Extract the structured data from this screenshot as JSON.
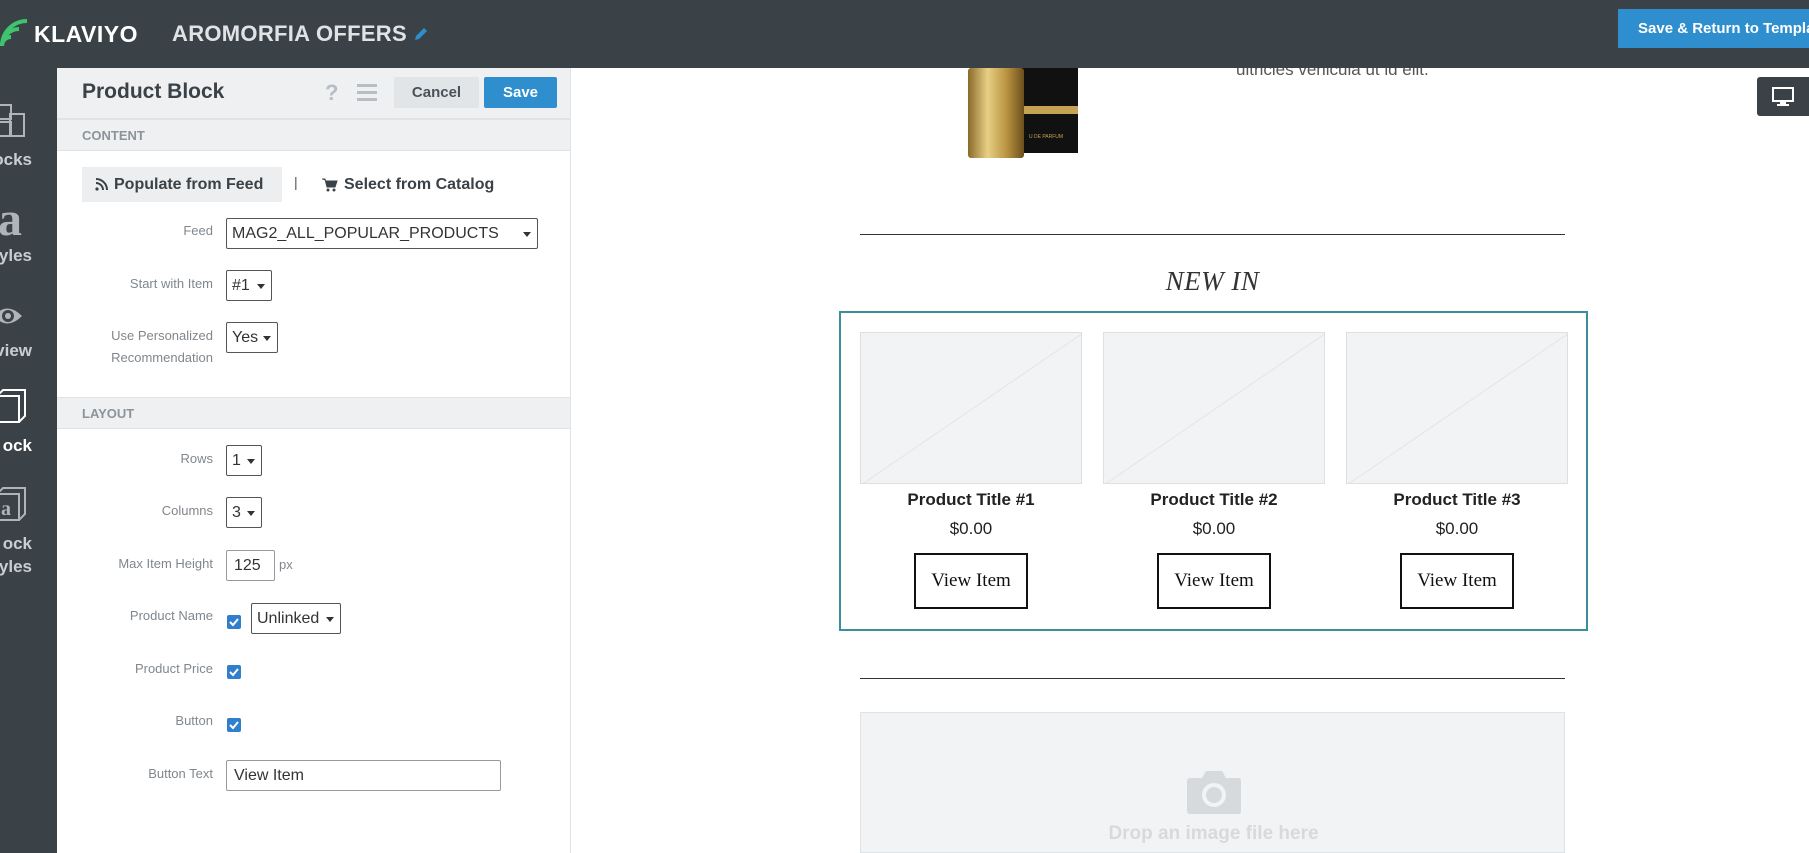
{
  "app": {
    "logo_text": "KLAVIYO",
    "campaign_title": "AROMORFIA OFFERS",
    "save_return_label": "Save & Return to Template"
  },
  "rail": {
    "items": [
      {
        "label": "ocks",
        "icon": "blocks-icon"
      },
      {
        "label": "yles",
        "icon": "styles-icon"
      },
      {
        "label": "eview",
        "icon": "preview-icon"
      },
      {
        "label": "ock",
        "icon": "block-icon"
      },
      {
        "label_line1": "ock",
        "label_line2": "yles",
        "icon": "block-styles-icon"
      }
    ]
  },
  "panel": {
    "title": "Product Block",
    "help": "?",
    "cancel_label": "Cancel",
    "save_label": "Save",
    "content_heading": "CONTENT",
    "populate_feed_label": "Populate from Feed",
    "separator": "|",
    "select_catalog_label": "Select from Catalog",
    "feed_label": "Feed",
    "feed_value": "MAG2_ALL_POPULAR_PRODUCTS",
    "start_label": "Start with Item",
    "start_value": "#1",
    "personalized_label_1": "Use Personalized",
    "personalized_label_2": "Recommendation",
    "personalized_value": "Yes",
    "layout_heading": "LAYOUT",
    "rows_label": "Rows",
    "rows_value": "1",
    "columns_label": "Columns",
    "columns_value": "3",
    "max_height_label": "Max Item Height",
    "max_height_value": "125",
    "max_height_unit": "px",
    "product_name_label": "Product Name",
    "product_name_checked": true,
    "product_name_link_value": "Unlinked",
    "product_price_label": "Product Price",
    "product_price_checked": true,
    "button_label": "Button",
    "button_checked": true,
    "button_text_label": "Button Text",
    "button_text_value": "View Item"
  },
  "canvas": {
    "lorem_text": "ultricies vehicula ut id elit.",
    "bottle_label": "U DE PARFUM",
    "section_heading": "NEW IN",
    "products": [
      {
        "title": "Product Title #1",
        "price": "$0.00",
        "button": "View Item"
      },
      {
        "title": "Product Title #2",
        "price": "$0.00",
        "button": "View Item"
      },
      {
        "title": "Product Title #3",
        "price": "$0.00",
        "button": "View Item"
      }
    ],
    "drop_text": "Drop an image file here"
  },
  "colors": {
    "topbar": "#3b4247",
    "accent": "#2f8fce",
    "block_outline": "#3a8f9c"
  }
}
